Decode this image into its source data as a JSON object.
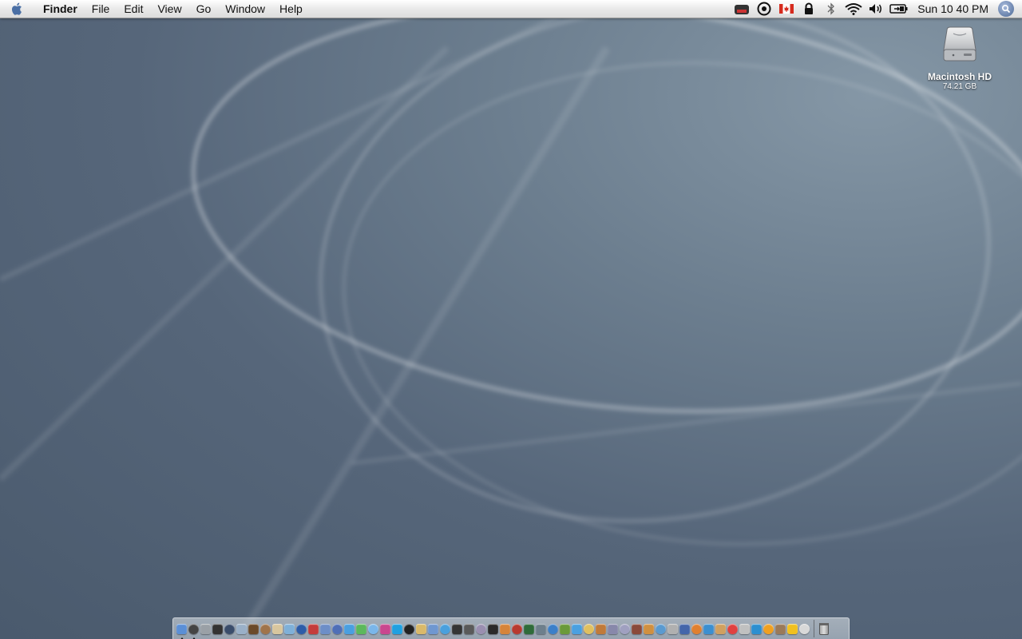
{
  "menubar": {
    "app_name": "Finder",
    "menus": [
      "File",
      "Edit",
      "View",
      "Go",
      "Window",
      "Help"
    ],
    "extras": [
      {
        "name": "battery-status-icon"
      },
      {
        "name": "sync-icon"
      },
      {
        "name": "canada-flag-icon"
      },
      {
        "name": "lock-icon"
      },
      {
        "name": "bluetooth-icon"
      },
      {
        "name": "wifi-icon"
      },
      {
        "name": "volume-icon"
      },
      {
        "name": "battery-icon"
      }
    ],
    "clock": "Sun 10 40 PM"
  },
  "desktop": {
    "drive": {
      "name": "Macintosh HD",
      "size": "74.21 GB"
    }
  },
  "dock": {
    "app_colors": [
      "#5b8fd6",
      "#444444",
      "#9aa0a6",
      "#333333",
      "#3a4d6b",
      "#9ab0c8",
      "#6b4a2a",
      "#a0744b",
      "#d8c69e",
      "#7fb0d8",
      "#2d5ca8",
      "#c43c3c",
      "#6d8ec7",
      "#4f6fb7",
      "#4a9fe0",
      "#5cb85c",
      "#7ab6ea",
      "#c9478f",
      "#1fa0e0",
      "#222222",
      "#d9b96a",
      "#6f97d0",
      "#4aa0dd",
      "#353535",
      "#5a5a5a",
      "#9a8fb0",
      "#2a2a2a",
      "#d6843a",
      "#b83a30",
      "#2f6b3a",
      "#6e7f8c",
      "#3b7fc9",
      "#6a9a3a",
      "#4aa0e0",
      "#e0c060",
      "#c07a3a",
      "#8888aa",
      "#a0a0c0",
      "#8a4a3a",
      "#d09040",
      "#5a9ad0",
      "#b0b0b0",
      "#4466aa",
      "#e08030",
      "#3c8fd0",
      "#d0a060",
      "#e04040",
      "#c0c0c0",
      "#2c8fd0",
      "#f0a020",
      "#9a7a5a",
      "#f0c020",
      "#d8d8d8"
    ],
    "running_indices": [
      0,
      1
    ]
  },
  "colors": {
    "menubar_text": "#111111",
    "desktop_label": "#ffffff"
  }
}
